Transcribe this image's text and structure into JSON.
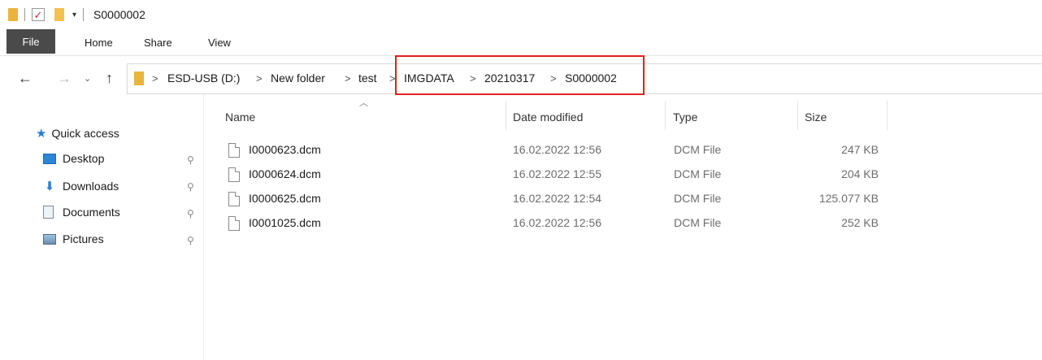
{
  "window": {
    "title": "S0000002"
  },
  "ribbon": {
    "file": "File",
    "home": "Home",
    "share": "Share",
    "view": "View"
  },
  "address": {
    "crumbs": [
      "ESD-USB (D:)",
      "New folder",
      "test",
      "IMGDATA",
      "20210317",
      "S0000002"
    ],
    "separator": ">"
  },
  "nav_glyphs": {
    "back": "←",
    "forward": "→",
    "recent": "⌄",
    "up": "↑",
    "pin": "📌"
  },
  "sidebar": {
    "quick_access": "Quick access",
    "items": [
      {
        "label": "Desktop",
        "icon": "desktop-icon",
        "pinned": true
      },
      {
        "label": "Downloads",
        "icon": "downloads-icon",
        "pinned": true
      },
      {
        "label": "Documents",
        "icon": "documents-icon",
        "pinned": true
      },
      {
        "label": "Pictures",
        "icon": "pictures-icon",
        "pinned": true
      }
    ]
  },
  "columns": {
    "name": "Name",
    "date": "Date modified",
    "type": "Type",
    "size": "Size"
  },
  "files": [
    {
      "name": "I0000623.dcm",
      "date": "16.02.2022 12:56",
      "type": "DCM File",
      "size": "247 KB"
    },
    {
      "name": "I0000624.dcm",
      "date": "16.02.2022 12:55",
      "type": "DCM File",
      "size": "204 KB"
    },
    {
      "name": "I0000625.dcm",
      "date": "16.02.2022 12:54",
      "type": "DCM File",
      "size": "125.077 KB"
    },
    {
      "name": "I0001025.dcm",
      "date": "16.02.2022 12:56",
      "type": "DCM File",
      "size": "252 KB"
    }
  ],
  "colors": {
    "highlight": "#e02020",
    "file_tab_bg": "#4a4a4a",
    "folder": "#e8b43c",
    "quick_access_star": "#2b7cd3"
  }
}
